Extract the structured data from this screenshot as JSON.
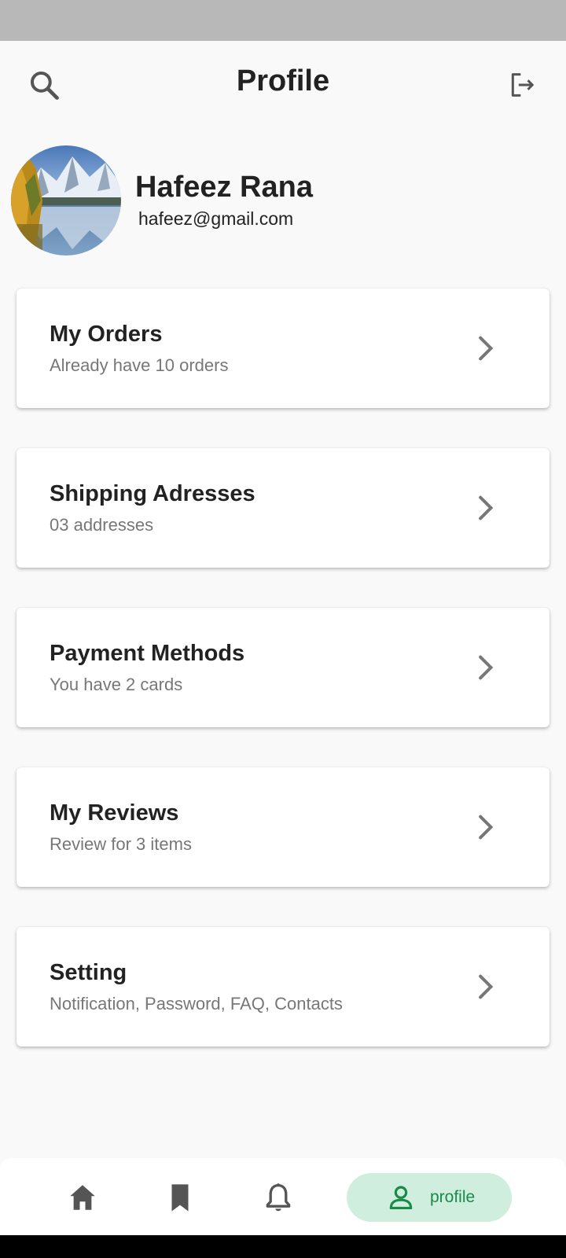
{
  "app_bar": {
    "title": "Profile",
    "search_icon": "search-icon",
    "logout_icon": "logout-icon"
  },
  "profile": {
    "name": "Hafeez Rana",
    "email": "hafeez@gmail.com",
    "avatar": "mountain-lake-photo"
  },
  "menu": [
    {
      "title": "My Orders",
      "subtitle": "Already have 10 orders"
    },
    {
      "title": "Shipping Adresses",
      "subtitle": "03 addresses"
    },
    {
      "title": "Payment Methods",
      "subtitle": "You have 2 cards"
    },
    {
      "title": "My Reviews",
      "subtitle": "Review for 3 items"
    },
    {
      "title": "Setting",
      "subtitle": "Notification, Password, FAQ, Contacts"
    }
  ],
  "bottom_nav": {
    "items": [
      "home-icon",
      "bookmark-icon",
      "bell-icon",
      "person-icon"
    ],
    "active_label": "profile",
    "active_color": "#1a8a4a",
    "active_bg": "#cfeedd"
  }
}
